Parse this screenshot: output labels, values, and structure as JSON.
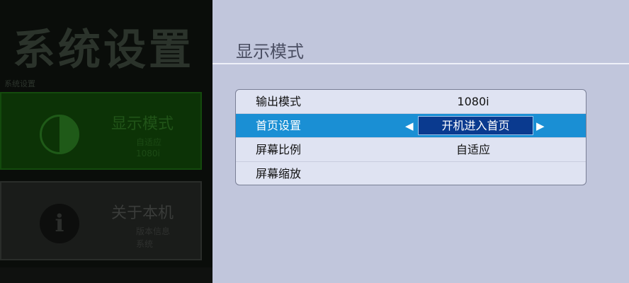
{
  "background_screen": {
    "title": "系统设置",
    "breadcrumb": "系统设置",
    "cards": [
      {
        "title": "显示模式",
        "sub1": "自适应",
        "sub2": "1080i",
        "icon": "half-circle-icon"
      },
      {
        "title": "关于本机",
        "sub1": "版本信息",
        "sub2": "系统",
        "icon": "info-icon"
      }
    ]
  },
  "panel": {
    "title": "显示模式",
    "rows": [
      {
        "label": "输出模式",
        "value": "1080i"
      },
      {
        "label": "首页设置",
        "value": "开机进入首页",
        "selected": true
      },
      {
        "label": "屏幕比例",
        "value": "自适应"
      },
      {
        "label": "屏幕缩放",
        "value": ""
      }
    ],
    "arrow_left": "◀",
    "arrow_right": "▶"
  },
  "colors": {
    "panel_bg": "#c1c6dc",
    "list_bg": "#dfe3f2",
    "selected_row": "#1a8fd4",
    "selected_value_box": "#0a3a8f",
    "dimmed_green_card": "#0c3306"
  }
}
